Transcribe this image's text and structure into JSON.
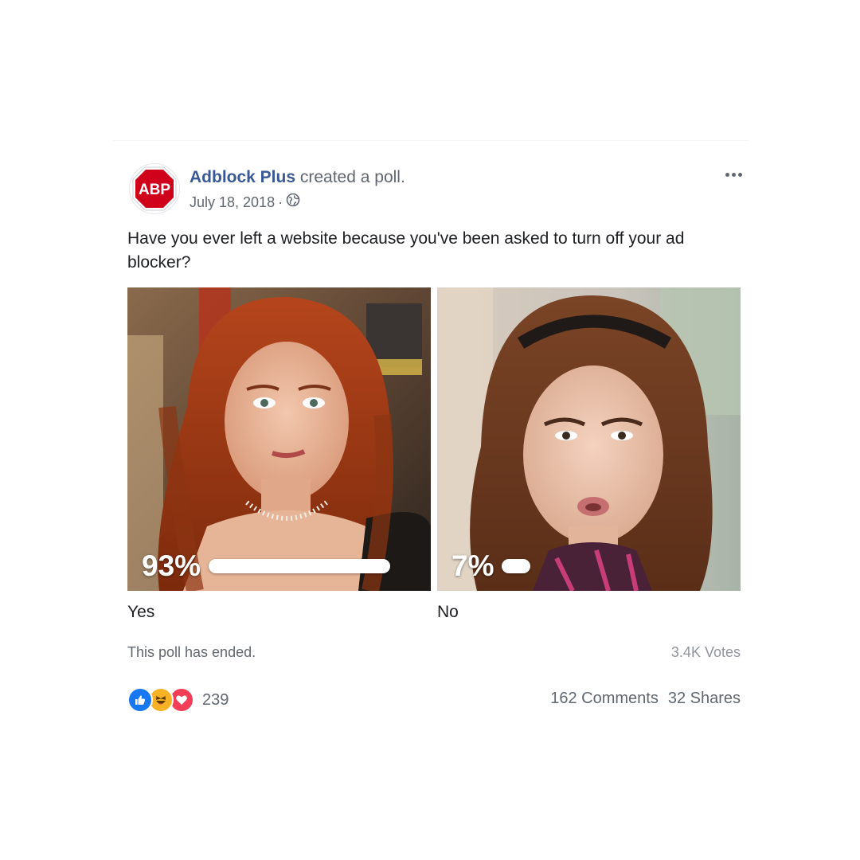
{
  "post": {
    "page_name": "Adblock Plus",
    "action": "created a poll.",
    "date": "July 18, 2018",
    "separator": "·",
    "avatar_text": "ABP",
    "privacy_icon": "globe-icon",
    "more_icon": "more-options-icon",
    "question": "Have you ever left a website because you've been asked to turn off your ad blocker?"
  },
  "poll": {
    "options": [
      {
        "label": "Yes",
        "percent_text": "93%",
        "percent": 93
      },
      {
        "label": "No",
        "percent_text": "7%",
        "percent": 7
      }
    ],
    "status": "This poll has ended.",
    "votes": "3.4K Votes"
  },
  "footer": {
    "reaction_icons": [
      "like-icon",
      "haha-icon",
      "love-icon"
    ],
    "reaction_count": "239",
    "comments": "162 Comments",
    "shares": "32 Shares"
  },
  "colors": {
    "page_name": "#385898",
    "abp_red": "#d0021b",
    "like": "#1877f2",
    "haha": "#f7b125",
    "love": "#f33e58"
  }
}
